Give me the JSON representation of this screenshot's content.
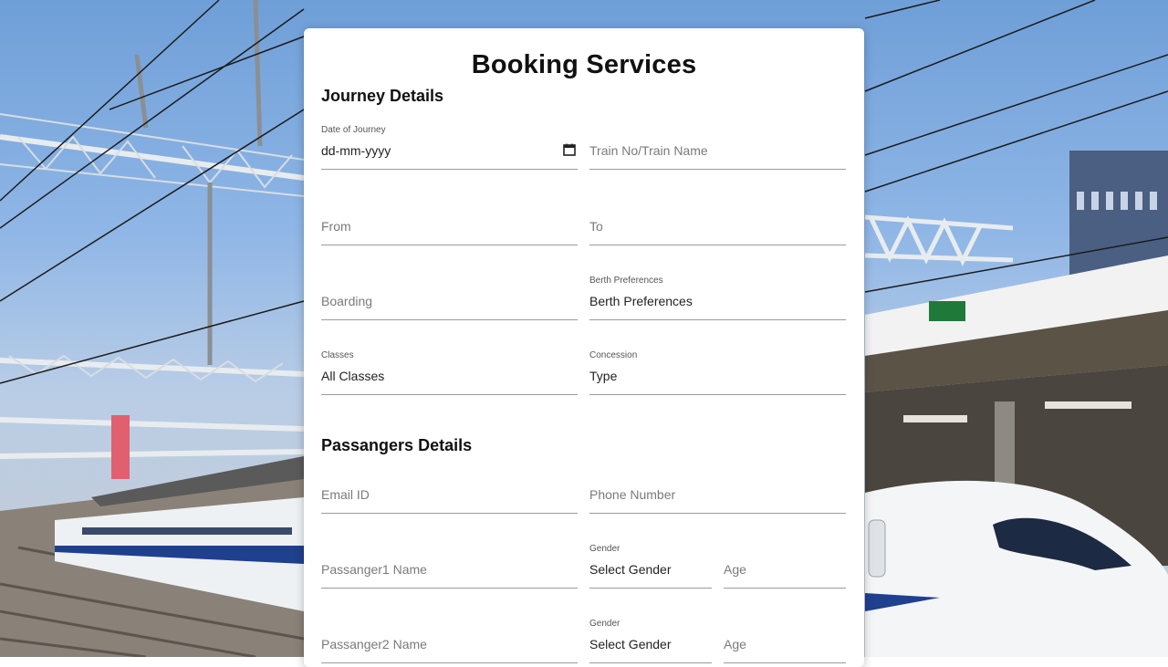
{
  "form": {
    "title": "Booking Services",
    "journey_section": "Journey Details",
    "passengers_section": "Passangers Details",
    "date_of_journey": {
      "label": "Date of Journey",
      "value": "dd-mm-yyyy"
    },
    "train": {
      "placeholder": "Train No/Train Name"
    },
    "from": {
      "placeholder": "From"
    },
    "to": {
      "placeholder": "To"
    },
    "boarding": {
      "placeholder": "Boarding"
    },
    "berth": {
      "label": "Berth Preferences",
      "value": "Berth Preferences"
    },
    "classes": {
      "label": "Classes",
      "value": "All Classes"
    },
    "concession": {
      "label": "Concession",
      "value": "Type"
    },
    "email": {
      "placeholder": "Email ID"
    },
    "phone": {
      "placeholder": "Phone Number"
    },
    "passenger1": {
      "name_placeholder": "Passanger1 Name",
      "gender_label": "Gender",
      "gender_value": "Select Gender",
      "age_placeholder": "Age"
    },
    "passenger2": {
      "name_placeholder": "Passanger2 Name",
      "gender_label": "Gender",
      "gender_value": "Select Gender",
      "age_placeholder": "Age"
    }
  },
  "icons": {
    "date_picker": "calendar-icon"
  },
  "colors": {
    "card": "#ffffff",
    "underline": "#9b9b9b",
    "sky": "#7aa6dc"
  }
}
